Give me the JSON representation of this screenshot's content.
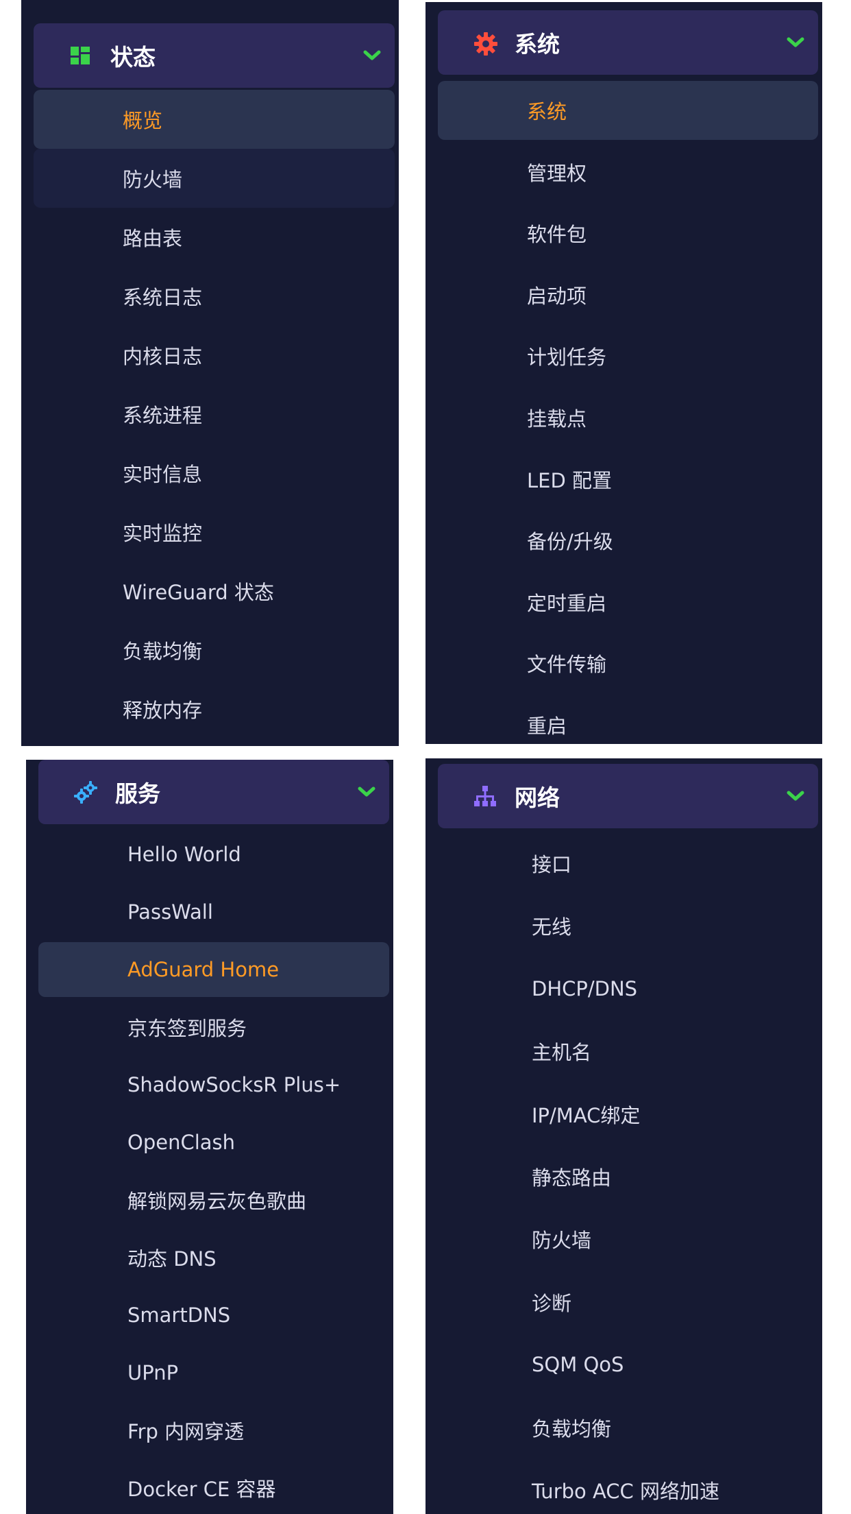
{
  "panels": [
    {
      "id": "status",
      "title": "状态",
      "icon": "dashboard-icon",
      "items": [
        "概览",
        "防火墙",
        "路由表",
        "系统日志",
        "内核日志",
        "系统进程",
        "实时信息",
        "实时监控",
        "WireGuard 状态",
        "负载均衡",
        "释放内存"
      ],
      "active_index": 0,
      "hover_index": 1
    },
    {
      "id": "system",
      "title": "系统",
      "icon": "gear-icon",
      "items": [
        "系统",
        "管理权",
        "软件包",
        "启动项",
        "计划任务",
        "挂载点",
        "LED 配置",
        "备份/升级",
        "定时重启",
        "文件传输",
        "重启"
      ],
      "active_index": 0
    },
    {
      "id": "services",
      "title": "服务",
      "icon": "cogs-icon",
      "items": [
        "Hello World",
        "PassWall",
        "AdGuard Home",
        "京东签到服务",
        "ShadowSocksR Plus+",
        "OpenClash",
        "解锁网易云灰色歌曲",
        "动态 DNS",
        "SmartDNS",
        "UPnP",
        "Frp 内网穿透",
        "Docker CE 容器"
      ],
      "active_index": 2
    },
    {
      "id": "network",
      "title": "网络",
      "icon": "sitemap-icon",
      "items": [
        "接口",
        "无线",
        "DHCP/DNS",
        "主机名",
        "IP/MAC绑定",
        "静态路由",
        "防火墙",
        "诊断",
        "SQM QoS",
        "负载均衡",
        "Turbo ACC 网络加速"
      ]
    }
  ],
  "colors": {
    "panel_bg": "#161a33",
    "header_bg": "#2e2a5b",
    "active_bg": "#2b3450",
    "active_text": "#ff9b25",
    "text": "#dbdceb",
    "chevron": "#3bd34a"
  }
}
